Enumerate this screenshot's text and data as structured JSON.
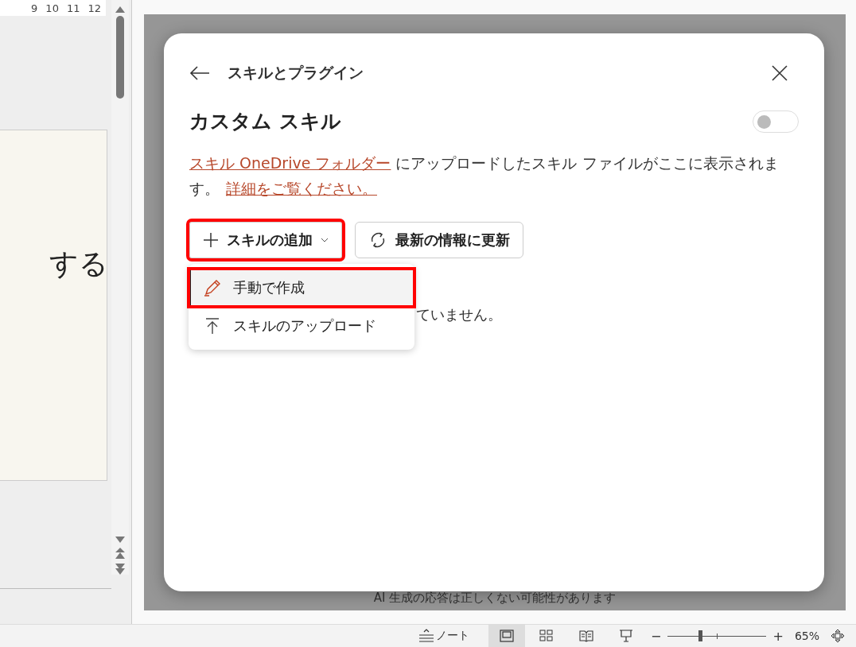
{
  "ruler": {
    "numbers": [
      "9",
      "10",
      "11",
      "12"
    ]
  },
  "slide": {
    "text": "する"
  },
  "pane_footer": {
    "text": "AI 生成の応答は正しくない可能性があります"
  },
  "dialog": {
    "title": "スキルとプラグイン",
    "section": {
      "heading": "カスタム スキル",
      "toggle": {
        "on": false
      }
    },
    "description": {
      "link": "スキル OneDrive フォルダー",
      "text": " にアップロードしたスキル ファイルがここに表示されます。",
      "more_link": "詳細をご覧ください。"
    },
    "add_button": {
      "label": "スキルの追加",
      "highlighted": true
    },
    "refresh_button": {
      "label": "最新の情報に更新"
    },
    "empty_text": "ていません。",
    "menu": [
      {
        "label": "手動で作成",
        "kind": "create",
        "selected": true
      },
      {
        "label": "スキルのアップロード",
        "kind": "upload",
        "selected": false
      }
    ]
  },
  "status_bar": {
    "notes": "ノート",
    "views": [
      {
        "kind": "normal",
        "selected": true
      },
      {
        "kind": "sorter",
        "selected": false
      },
      {
        "kind": "reading",
        "selected": false
      },
      {
        "kind": "presenter",
        "selected": false
      }
    ],
    "zoom_minus": "−",
    "zoom_plus": "+",
    "zoom": {
      "level": 0.33
    },
    "zoom_text": "65%"
  }
}
